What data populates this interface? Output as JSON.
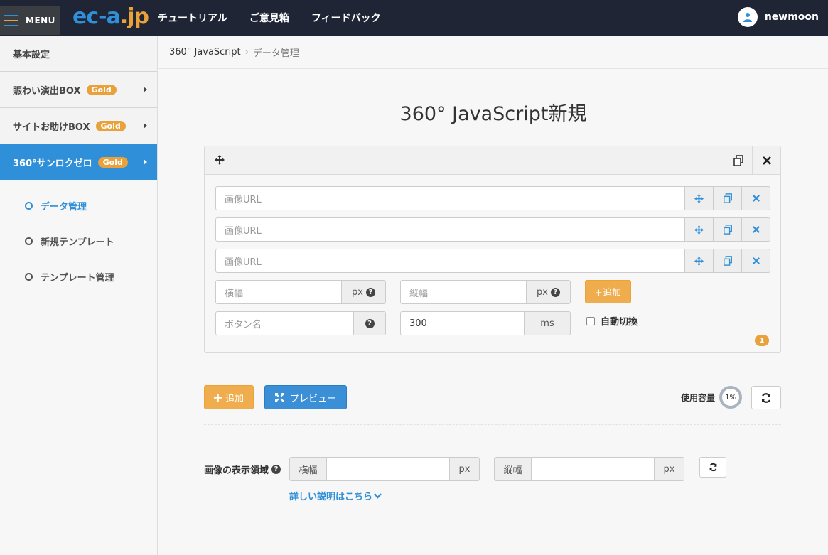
{
  "topbar": {
    "menu_label": "MENU",
    "logo_part1": "ec-a",
    "logo_part2": ".jp",
    "nav": [
      "チュートリアル",
      "ご意見箱",
      "フィードバック"
    ],
    "username": "newmoon"
  },
  "sidebar": {
    "items": [
      {
        "label": "基本設定",
        "badge": ""
      },
      {
        "label": "賑わい演出BOX",
        "badge": "Gold"
      },
      {
        "label": "サイトお助けBOX",
        "badge": "Gold"
      },
      {
        "label": "360°サンロクゼロ",
        "badge": "Gold"
      }
    ],
    "submenu": [
      "データ管理",
      "新規テンプレート",
      "テンプレート管理"
    ]
  },
  "breadcrumb": {
    "root": "360° JavaScript",
    "current": "データ管理"
  },
  "page_title": "360° JavaScript新規",
  "panel": {
    "url_placeholder": "画像URL",
    "width_placeholder": "横幅",
    "height_placeholder": "縦幅",
    "unit_px": "px",
    "add_label": "+追加",
    "button_name_placeholder": "ボタン名",
    "interval_value": "300",
    "unit_ms": "ms",
    "auto_switch_label": "自動切換",
    "count": "1"
  },
  "actions": {
    "add_label": "追加",
    "preview_label": "プレビュー",
    "usage_label": "使用容量",
    "usage_value": "1%"
  },
  "display_area": {
    "label": "画像の表示領域",
    "width_label": "横幅",
    "height_label": "縦幅",
    "unit": "px",
    "detail_link": "詳しい説明はこちら"
  },
  "colors": {
    "accent_blue": "#2f8fd8",
    "accent_orange": "#e9a13b",
    "topbar": "#1f2535"
  }
}
